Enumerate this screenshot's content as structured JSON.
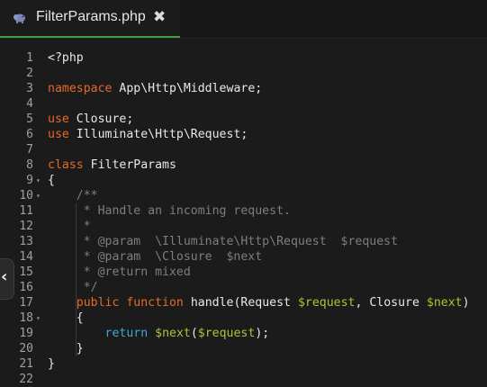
{
  "tab": {
    "title": "FilterParams.php",
    "close_glyph": "✖",
    "icon": "php-elephant-icon",
    "active_color": "#3d9e45"
  },
  "side_toggle": {
    "glyph": "‹",
    "icon": "chevron-left-icon"
  },
  "colors": {
    "keyword": "#e56a2a",
    "variable": "#a6c732",
    "comment": "#7e7e7e",
    "return_keyword": "#3fa8d8",
    "default_text": "#e8e8e8"
  },
  "lines": [
    {
      "num": "1",
      "fold": "",
      "tokens": [
        {
          "t": "<?php",
          "c": ""
        }
      ]
    },
    {
      "num": "2",
      "fold": "",
      "tokens": []
    },
    {
      "num": "3",
      "fold": "",
      "tokens": [
        {
          "t": "namespace",
          "c": "kw"
        },
        {
          "t": " App\\Http\\Middleware;",
          "c": ""
        }
      ]
    },
    {
      "num": "4",
      "fold": "",
      "tokens": []
    },
    {
      "num": "5",
      "fold": "",
      "tokens": [
        {
          "t": "use",
          "c": "kw"
        },
        {
          "t": " Closure;",
          "c": ""
        }
      ]
    },
    {
      "num": "6",
      "fold": "",
      "tokens": [
        {
          "t": "use",
          "c": "kw"
        },
        {
          "t": " Illuminate\\Http\\Request;",
          "c": ""
        }
      ]
    },
    {
      "num": "7",
      "fold": "",
      "tokens": []
    },
    {
      "num": "8",
      "fold": "",
      "tokens": [
        {
          "t": "class",
          "c": "kw"
        },
        {
          "t": " FilterParams",
          "c": ""
        }
      ]
    },
    {
      "num": "9",
      "fold": "▾",
      "tokens": [
        {
          "t": "{",
          "c": ""
        }
      ]
    },
    {
      "num": "10",
      "fold": "▾",
      "tokens": [
        {
          "t": "    /**",
          "c": "cm"
        }
      ]
    },
    {
      "num": "11",
      "fold": "",
      "tokens": [
        {
          "t": "     * Handle an incoming request.",
          "c": "cm"
        }
      ]
    },
    {
      "num": "12",
      "fold": "",
      "tokens": [
        {
          "t": "     *",
          "c": "cm"
        }
      ]
    },
    {
      "num": "13",
      "fold": "",
      "tokens": [
        {
          "t": "     * @param  \\Illuminate\\Http\\Request  $request",
          "c": "cm"
        }
      ]
    },
    {
      "num": "14",
      "fold": "",
      "tokens": [
        {
          "t": "     * @param  \\Closure  $next",
          "c": "cm"
        }
      ]
    },
    {
      "num": "15",
      "fold": "",
      "tokens": [
        {
          "t": "     * @return mixed",
          "c": "cm"
        }
      ]
    },
    {
      "num": "16",
      "fold": "",
      "tokens": [
        {
          "t": "     */",
          "c": "cm"
        }
      ]
    },
    {
      "num": "17",
      "fold": "",
      "tokens": [
        {
          "t": "    ",
          "c": ""
        },
        {
          "t": "public",
          "c": "kw"
        },
        {
          "t": " ",
          "c": ""
        },
        {
          "t": "function",
          "c": "kw"
        },
        {
          "t": " handle(Request ",
          "c": ""
        },
        {
          "t": "$request",
          "c": "var"
        },
        {
          "t": ", Closure ",
          "c": ""
        },
        {
          "t": "$next",
          "c": "var"
        },
        {
          "t": ")",
          "c": ""
        }
      ]
    },
    {
      "num": "18",
      "fold": "▾",
      "tokens": [
        {
          "t": "    {",
          "c": ""
        }
      ]
    },
    {
      "num": "19",
      "fold": "",
      "tokens": [
        {
          "t": "        ",
          "c": ""
        },
        {
          "t": "return",
          "c": "ret"
        },
        {
          "t": " ",
          "c": ""
        },
        {
          "t": "$next",
          "c": "var"
        },
        {
          "t": "(",
          "c": ""
        },
        {
          "t": "$request",
          "c": "var"
        },
        {
          "t": ");",
          "c": ""
        }
      ]
    },
    {
      "num": "20",
      "fold": "",
      "tokens": [
        {
          "t": "    }",
          "c": ""
        }
      ]
    },
    {
      "num": "21",
      "fold": "",
      "tokens": [
        {
          "t": "}",
          "c": ""
        }
      ]
    },
    {
      "num": "22",
      "fold": "",
      "tokens": []
    }
  ]
}
